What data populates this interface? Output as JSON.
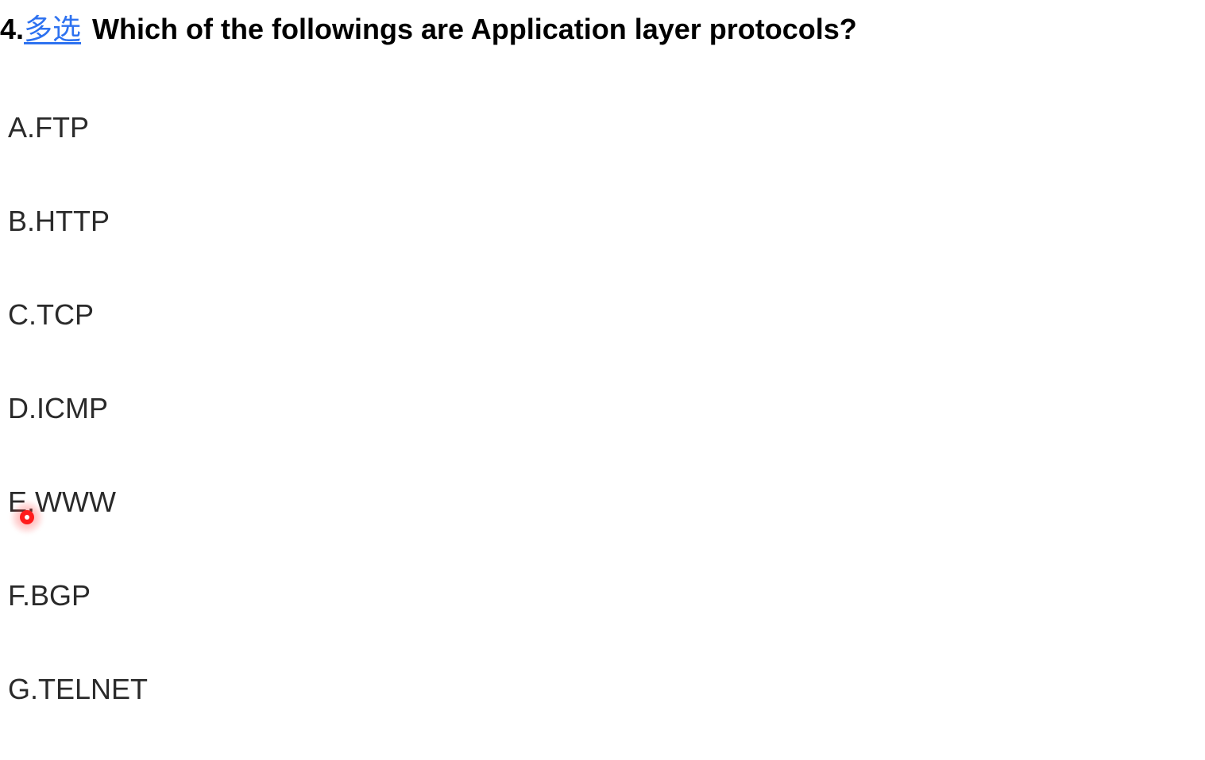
{
  "question": {
    "number": "4.",
    "type_label": "多选",
    "text": "Which of the followings are Application layer protocols?"
  },
  "options": [
    {
      "label": "A.",
      "text": "FTP"
    },
    {
      "label": "B.",
      "text": "HTTP"
    },
    {
      "label": "C.",
      "text": "TCP"
    },
    {
      "label": "D.",
      "text": "ICMP"
    },
    {
      "label": "E.",
      "text": "WWW"
    },
    {
      "label": "F.",
      "text": "BGP"
    },
    {
      "label": "G.",
      "text": "TELNET"
    }
  ]
}
